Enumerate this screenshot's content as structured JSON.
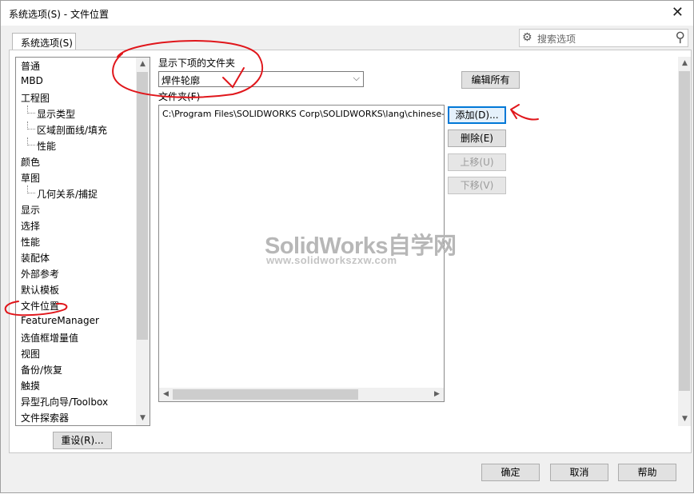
{
  "window": {
    "title": "系统选项(S) - 文件位置"
  },
  "tab": {
    "label": "系统选项(S)"
  },
  "search": {
    "placeholder": "搜索选项"
  },
  "tree": {
    "items": [
      {
        "label": "普通"
      },
      {
        "label": "MBD"
      },
      {
        "label": "工程图"
      },
      {
        "label": "显示类型",
        "sub": true
      },
      {
        "label": "区域剖面线/填充",
        "sub": true
      },
      {
        "label": "性能",
        "sub": true
      },
      {
        "label": "颜色"
      },
      {
        "label": "草图"
      },
      {
        "label": "几何关系/捕捉",
        "sub": true
      },
      {
        "label": "显示"
      },
      {
        "label": "选择"
      },
      {
        "label": "性能"
      },
      {
        "label": "装配体"
      },
      {
        "label": "外部参考"
      },
      {
        "label": "默认模板"
      },
      {
        "label": "文件位置"
      },
      {
        "label": "FeatureManager"
      },
      {
        "label": "选值框增量值"
      },
      {
        "label": "视图"
      },
      {
        "label": "备份/恢复"
      },
      {
        "label": "触摸"
      },
      {
        "label": "异型孔向导/Toolbox"
      },
      {
        "label": "文件探索器"
      }
    ]
  },
  "reset_button": "重设(R)...",
  "show_folders_label": "显示下项的文件夹",
  "folder_type": {
    "selected": "焊件轮廓"
  },
  "edit_all_button": "编辑所有",
  "folders_label": "文件夹(F)",
  "folders": [
    "C:\\Program Files\\SOLIDWORKS Corp\\SOLIDWORKS\\lang\\chinese-simp"
  ],
  "buttons": {
    "add": "添加(D)...",
    "delete": "删除(E)",
    "move_up": "上移(U)",
    "move_down": "下移(V)"
  },
  "footer": {
    "ok": "确定",
    "cancel": "取消",
    "help": "帮助"
  },
  "watermark": {
    "line1": "SolidWorks自学网",
    "line2": "www.solidworkszxw.com"
  },
  "colors": {
    "annotation": "#e0161b",
    "focus": "#0078d7"
  }
}
